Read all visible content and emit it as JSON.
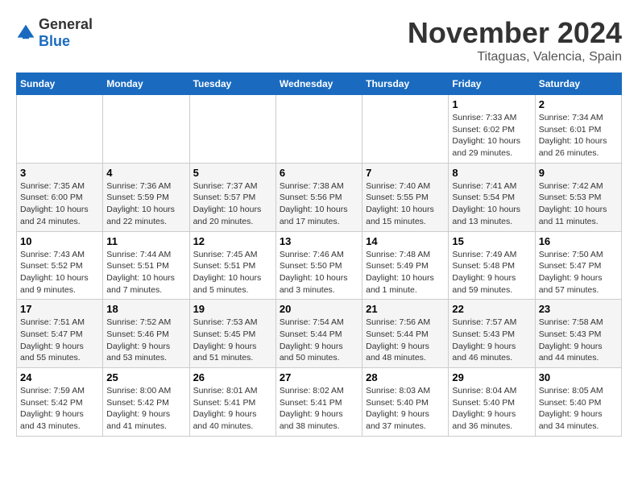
{
  "header": {
    "logo_general": "General",
    "logo_blue": "Blue",
    "month": "November 2024",
    "location": "Titaguas, Valencia, Spain"
  },
  "weekdays": [
    "Sunday",
    "Monday",
    "Tuesday",
    "Wednesday",
    "Thursday",
    "Friday",
    "Saturday"
  ],
  "weeks": [
    [
      {
        "day": "",
        "info": ""
      },
      {
        "day": "",
        "info": ""
      },
      {
        "day": "",
        "info": ""
      },
      {
        "day": "",
        "info": ""
      },
      {
        "day": "",
        "info": ""
      },
      {
        "day": "1",
        "info": "Sunrise: 7:33 AM\nSunset: 6:02 PM\nDaylight: 10 hours and 29 minutes."
      },
      {
        "day": "2",
        "info": "Sunrise: 7:34 AM\nSunset: 6:01 PM\nDaylight: 10 hours and 26 minutes."
      }
    ],
    [
      {
        "day": "3",
        "info": "Sunrise: 7:35 AM\nSunset: 6:00 PM\nDaylight: 10 hours and 24 minutes."
      },
      {
        "day": "4",
        "info": "Sunrise: 7:36 AM\nSunset: 5:59 PM\nDaylight: 10 hours and 22 minutes."
      },
      {
        "day": "5",
        "info": "Sunrise: 7:37 AM\nSunset: 5:57 PM\nDaylight: 10 hours and 20 minutes."
      },
      {
        "day": "6",
        "info": "Sunrise: 7:38 AM\nSunset: 5:56 PM\nDaylight: 10 hours and 17 minutes."
      },
      {
        "day": "7",
        "info": "Sunrise: 7:40 AM\nSunset: 5:55 PM\nDaylight: 10 hours and 15 minutes."
      },
      {
        "day": "8",
        "info": "Sunrise: 7:41 AM\nSunset: 5:54 PM\nDaylight: 10 hours and 13 minutes."
      },
      {
        "day": "9",
        "info": "Sunrise: 7:42 AM\nSunset: 5:53 PM\nDaylight: 10 hours and 11 minutes."
      }
    ],
    [
      {
        "day": "10",
        "info": "Sunrise: 7:43 AM\nSunset: 5:52 PM\nDaylight: 10 hours and 9 minutes."
      },
      {
        "day": "11",
        "info": "Sunrise: 7:44 AM\nSunset: 5:51 PM\nDaylight: 10 hours and 7 minutes."
      },
      {
        "day": "12",
        "info": "Sunrise: 7:45 AM\nSunset: 5:51 PM\nDaylight: 10 hours and 5 minutes."
      },
      {
        "day": "13",
        "info": "Sunrise: 7:46 AM\nSunset: 5:50 PM\nDaylight: 10 hours and 3 minutes."
      },
      {
        "day": "14",
        "info": "Sunrise: 7:48 AM\nSunset: 5:49 PM\nDaylight: 10 hours and 1 minute."
      },
      {
        "day": "15",
        "info": "Sunrise: 7:49 AM\nSunset: 5:48 PM\nDaylight: 9 hours and 59 minutes."
      },
      {
        "day": "16",
        "info": "Sunrise: 7:50 AM\nSunset: 5:47 PM\nDaylight: 9 hours and 57 minutes."
      }
    ],
    [
      {
        "day": "17",
        "info": "Sunrise: 7:51 AM\nSunset: 5:47 PM\nDaylight: 9 hours and 55 minutes."
      },
      {
        "day": "18",
        "info": "Sunrise: 7:52 AM\nSunset: 5:46 PM\nDaylight: 9 hours and 53 minutes."
      },
      {
        "day": "19",
        "info": "Sunrise: 7:53 AM\nSunset: 5:45 PM\nDaylight: 9 hours and 51 minutes."
      },
      {
        "day": "20",
        "info": "Sunrise: 7:54 AM\nSunset: 5:44 PM\nDaylight: 9 hours and 50 minutes."
      },
      {
        "day": "21",
        "info": "Sunrise: 7:56 AM\nSunset: 5:44 PM\nDaylight: 9 hours and 48 minutes."
      },
      {
        "day": "22",
        "info": "Sunrise: 7:57 AM\nSunset: 5:43 PM\nDaylight: 9 hours and 46 minutes."
      },
      {
        "day": "23",
        "info": "Sunrise: 7:58 AM\nSunset: 5:43 PM\nDaylight: 9 hours and 44 minutes."
      }
    ],
    [
      {
        "day": "24",
        "info": "Sunrise: 7:59 AM\nSunset: 5:42 PM\nDaylight: 9 hours and 43 minutes."
      },
      {
        "day": "25",
        "info": "Sunrise: 8:00 AM\nSunset: 5:42 PM\nDaylight: 9 hours and 41 minutes."
      },
      {
        "day": "26",
        "info": "Sunrise: 8:01 AM\nSunset: 5:41 PM\nDaylight: 9 hours and 40 minutes."
      },
      {
        "day": "27",
        "info": "Sunrise: 8:02 AM\nSunset: 5:41 PM\nDaylight: 9 hours and 38 minutes."
      },
      {
        "day": "28",
        "info": "Sunrise: 8:03 AM\nSunset: 5:40 PM\nDaylight: 9 hours and 37 minutes."
      },
      {
        "day": "29",
        "info": "Sunrise: 8:04 AM\nSunset: 5:40 PM\nDaylight: 9 hours and 36 minutes."
      },
      {
        "day": "30",
        "info": "Sunrise: 8:05 AM\nSunset: 5:40 PM\nDaylight: 9 hours and 34 minutes."
      }
    ]
  ]
}
